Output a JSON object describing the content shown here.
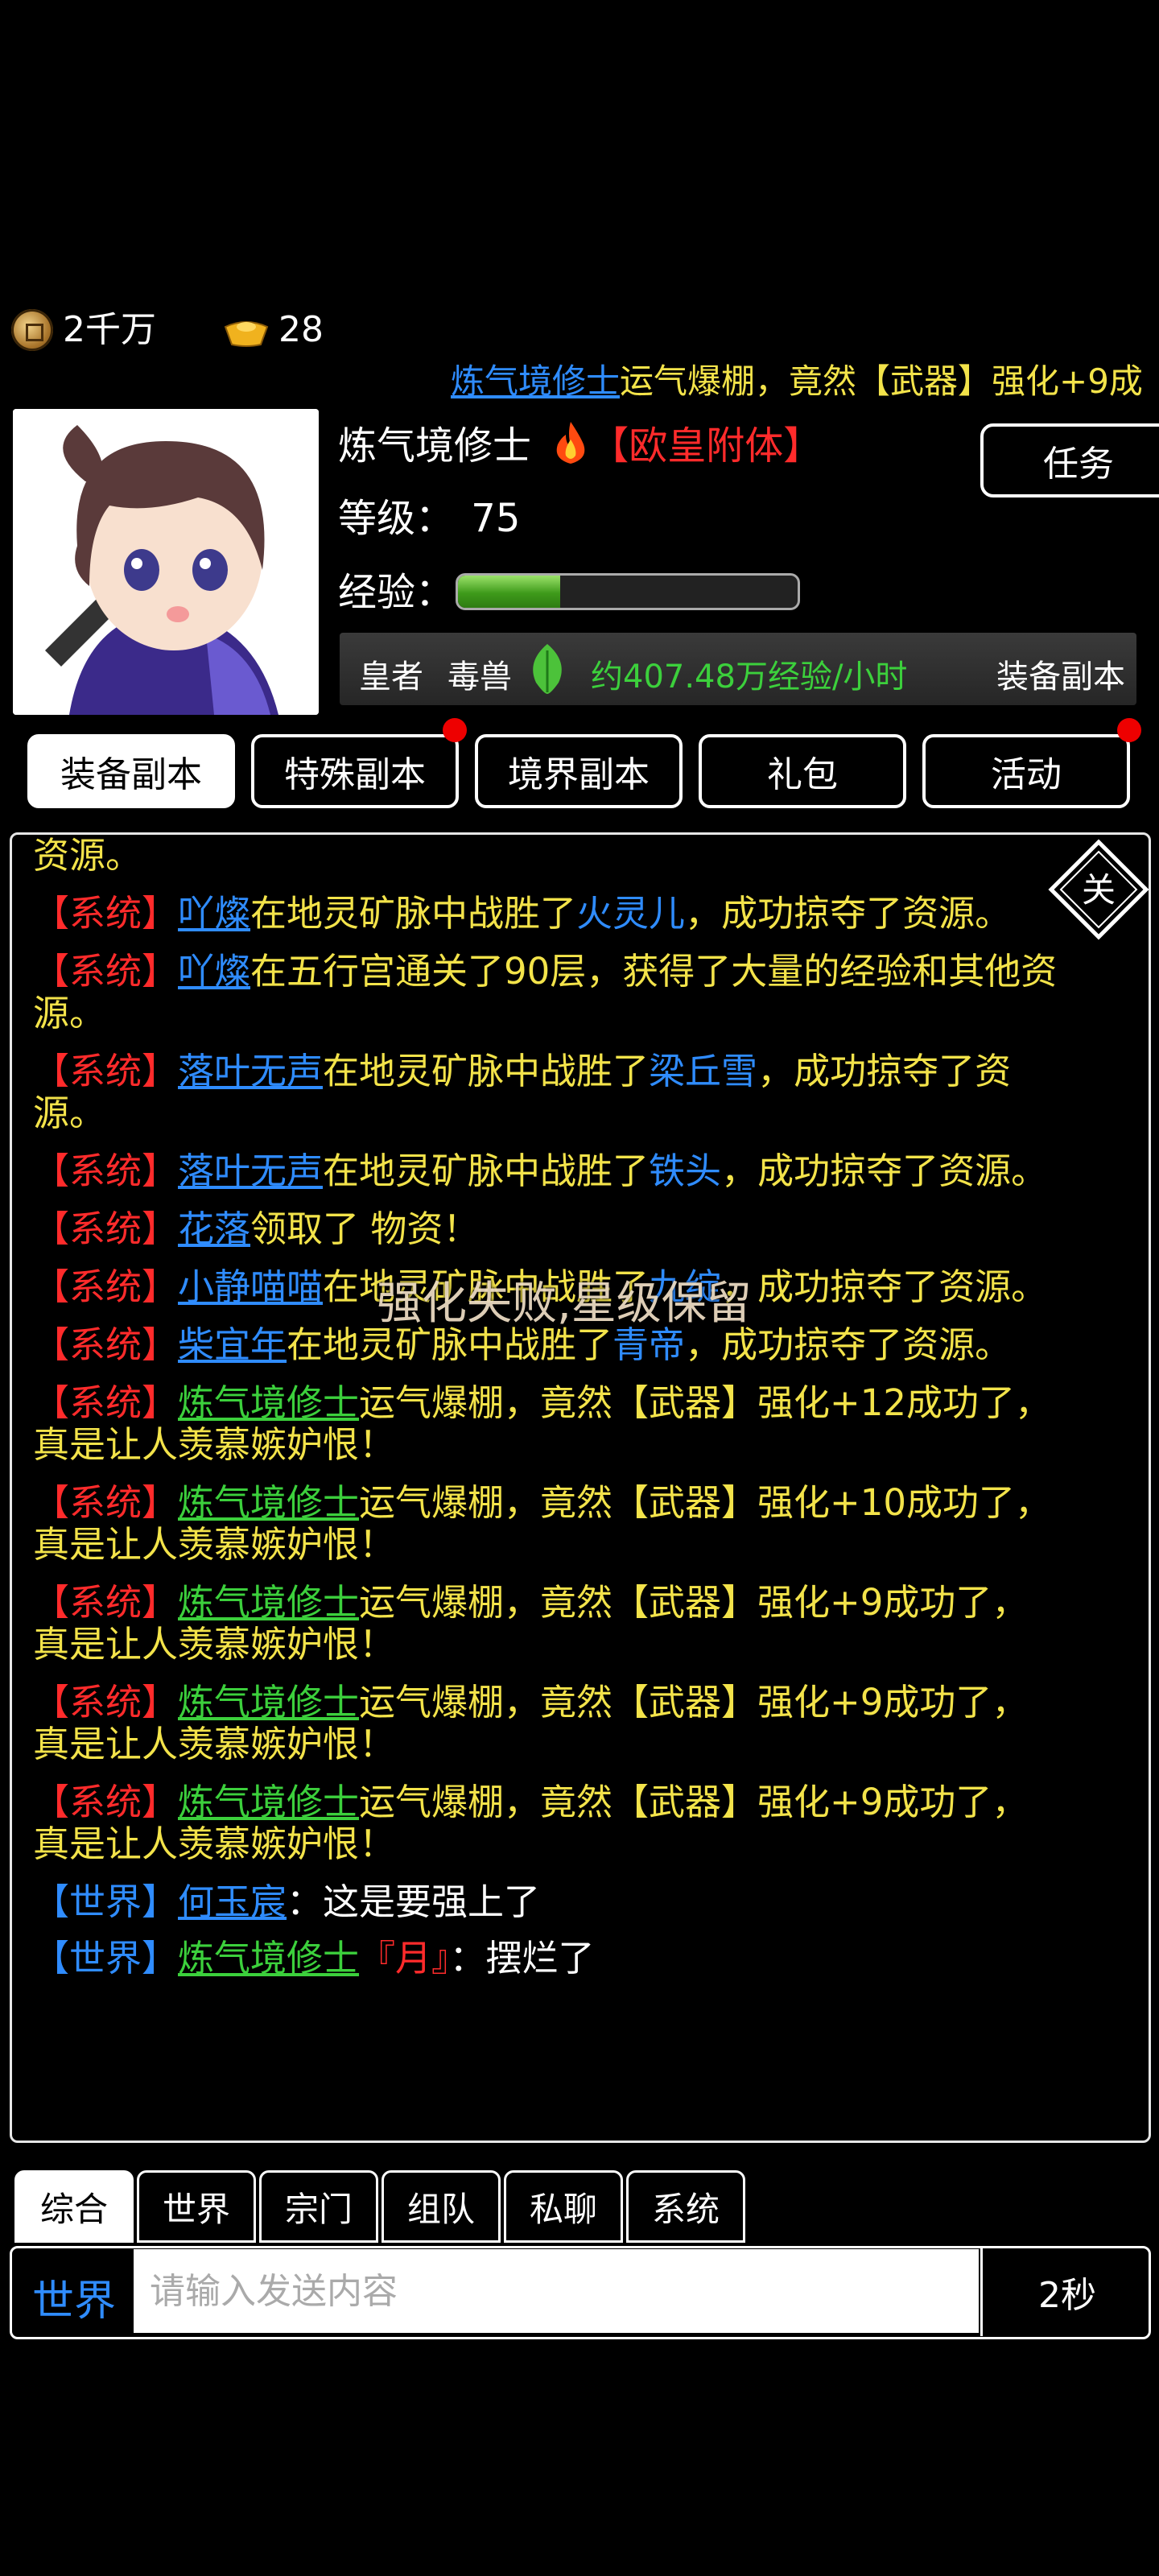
{
  "currency": {
    "coins": "2千万",
    "ingots": "28",
    "coin_icon": "copper-coin-icon",
    "ingot_icon": "gold-ingot-icon"
  },
  "marquee": {
    "player": "炼气境修士",
    "text": "运气爆棚，竟然【武器】强化+9成"
  },
  "profile": {
    "name": "炼气境修士",
    "vip": "【欧皇附体】",
    "task_label": "任务",
    "level_label": "等级：",
    "level": "75",
    "exp_label": "经验：",
    "exp_progress": 0.3,
    "rank": "皇者",
    "beast": "毒兽",
    "exp_rate": "约407.48万经验/小时",
    "dungeon": "装备副本"
  },
  "tabs": [
    "装备副本",
    "特殊副本",
    "境界副本",
    "礼包",
    "活动"
  ],
  "chat": {
    "close_label": "关",
    "toast": "强化失败,星级保留",
    "messages": [
      {
        "tag": "",
        "name": "",
        "name_color": "",
        "body": "资源。",
        "target": "",
        "rest": ""
      },
      {
        "tag": "【系统】",
        "name": "吖燦",
        "name_color": "blue",
        "body": "在地灵矿脉中战胜了",
        "target": "火灵儿",
        "rest": "，成功掠夺了资源。"
      },
      {
        "tag": "【系统】",
        "name": "吖燦",
        "name_color": "blue",
        "body": "在五行宫通关了90层，获得了大量的经验和其他资源。",
        "target": "",
        "rest": ""
      },
      {
        "tag": "【系统】",
        "name": "落叶无声",
        "name_color": "blue",
        "body": "在地灵矿脉中战胜了",
        "target": "梁丘雪",
        "rest": "，成功掠夺了资源。"
      },
      {
        "tag": "【系统】",
        "name": "落叶无声",
        "name_color": "blue",
        "body": "在地灵矿脉中战胜了",
        "target": "铁头",
        "rest": "，成功掠夺了资源。"
      },
      {
        "tag": "【系统】",
        "name": "花落",
        "name_color": "blue",
        "body": "领取了",
        "target": "",
        "rest": "                       物资！"
      },
      {
        "tag": "【系统】",
        "name": "小静喵喵",
        "name_color": "blue",
        "body": "在地灵矿脉中战胜了",
        "target": "九绽",
        "rest": "，成功掠夺了资源。"
      },
      {
        "tag": "【系统】",
        "name": "柴宜年",
        "name_color": "blue",
        "body": "在地灵矿脉中战胜了",
        "target": "青帝",
        "rest": "，成功掠夺了资源。"
      },
      {
        "tag": "【系统】",
        "name": "炼气境修士",
        "name_color": "green",
        "body": "运气爆棚，竟然【武器】强化+12成功了，真是让人羡慕嫉妒恨！",
        "target": "",
        "rest": ""
      },
      {
        "tag": "【系统】",
        "name": "炼气境修士",
        "name_color": "green",
        "body": "运气爆棚，竟然【武器】强化+10成功了，真是让人羡慕嫉妒恨！",
        "target": "",
        "rest": ""
      },
      {
        "tag": "【系统】",
        "name": "炼气境修士",
        "name_color": "green",
        "body": "运气爆棚，竟然【武器】强化+9成功了，真是让人羡慕嫉妒恨！",
        "target": "",
        "rest": ""
      },
      {
        "tag": "【系统】",
        "name": "炼气境修士",
        "name_color": "green",
        "body": "运气爆棚，竟然【武器】强化+9成功了，真是让人羡慕嫉妒恨！",
        "target": "",
        "rest": ""
      },
      {
        "tag": "【系统】",
        "name": "炼气境修士",
        "name_color": "green",
        "body": "运气爆棚，竟然【武器】强化+9成功了，真是让人羡慕嫉妒恨！",
        "target": "",
        "rest": ""
      }
    ],
    "world_msgs": [
      {
        "tag": "【世界】",
        "name": "何玉宸",
        "name_color": "blue",
        "title": "",
        "text": "：这是要强上了"
      },
      {
        "tag": "【世界】",
        "name": "炼气境修士",
        "name_color": "green",
        "title": "『月』",
        "text": "：摆烂了"
      }
    ]
  },
  "chat_tabs": [
    "综合",
    "世界",
    "宗门",
    "组队",
    "私聊",
    "系统"
  ],
  "input": {
    "channel": "世界",
    "placeholder": "请输入发送内容",
    "send_label": "2秒"
  },
  "colors": {
    "system_red": "#ff2b2b",
    "name_blue": "#2f8cff",
    "name_green": "#3cd03c",
    "body_yellow": "#f3e34a"
  }
}
